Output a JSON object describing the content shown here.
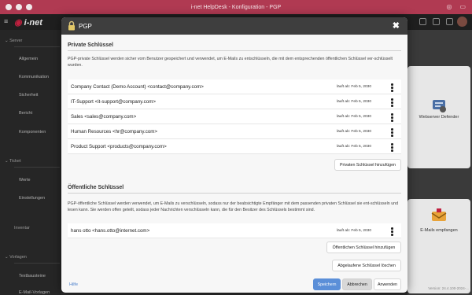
{
  "window": {
    "title": "i-net HelpDesk - Konfiguration - PGP"
  },
  "app": {
    "logo_text": "i-net"
  },
  "sidebar": {
    "server": "Server",
    "items": [
      "Allgemein",
      "Kommunikation",
      "Sicherheit",
      "Bericht",
      "Komponenten"
    ],
    "ticket": "Ticket",
    "ticket_items": [
      "Werte",
      "Einstellungen"
    ],
    "inventar": "Inventar",
    "vorlagen": "Vorlagen",
    "vorlagen_items": [
      "Textbausteine",
      "E-Mail-Vorlagen"
    ]
  },
  "background": {
    "card1_label": "Webserver Defender",
    "card2_label": "E-Mails empfangen",
    "version": "Version: 24.4.100-2024-..."
  },
  "modal": {
    "title": "PGP",
    "close": "✖",
    "private": {
      "title": "Private Schlüssel",
      "description": "PGP-private Schlüssel werden sicher vom Benutzer gespeichert und verwendet, um E-Mails zu entschlüsseln, die mit dem entsprechenden öffentlichen Schlüssel ver-schlüsselt wurden.",
      "keys": [
        {
          "name": "Company Contact (Demo Account) <contact@company.com>",
          "expires": "läuft ab: Feb 5, 2030"
        },
        {
          "name": "IT-Support <it-support@company.com>",
          "expires": "läuft ab: Feb 5, 2030"
        },
        {
          "name": "Sales <sales@company.com>",
          "expires": "läuft ab: Feb 5, 2030"
        },
        {
          "name": "Human Resources <hr@company.com>",
          "expires": "läuft ab: Feb 5, 2030"
        },
        {
          "name": "Product Support <products@company.com>",
          "expires": "läuft ab: Feb 5, 2030"
        }
      ],
      "add_button": "Privaten Schlüssel hinzufügen"
    },
    "public": {
      "title": "Öffentliche Schlüssel",
      "description": "PGP-öffentliche Schlüssel werden verwendet, um E-Mails zu verschlüsseln, sodass nur der beabsichtigte Empfänger mit dem passenden privaten Schlüssel sie ent-schlüsseln und lesen kann. Sie werden offen geteilt, sodass jeder Nachrichten verschlüsseln kann, die für den Besitzer des Schlüssels bestimmt sind.",
      "keys": [
        {
          "name": "hans otto <hans.otto@internet.com>",
          "expires": "läuft ab: Feb 5, 2030"
        }
      ],
      "add_button": "Öffentlichen Schlüssel hinzufügen",
      "delete_expired_button": "Abgelaufene Schlüssel löschen"
    },
    "footer": {
      "help": "Hilfe",
      "save": "Speichern",
      "cancel": "Abbrechen",
      "apply": "Anwenden"
    }
  },
  "colors": {
    "titlebar": "#b03a52",
    "primary": "#5b8fd8",
    "brand": "#c1203f"
  }
}
